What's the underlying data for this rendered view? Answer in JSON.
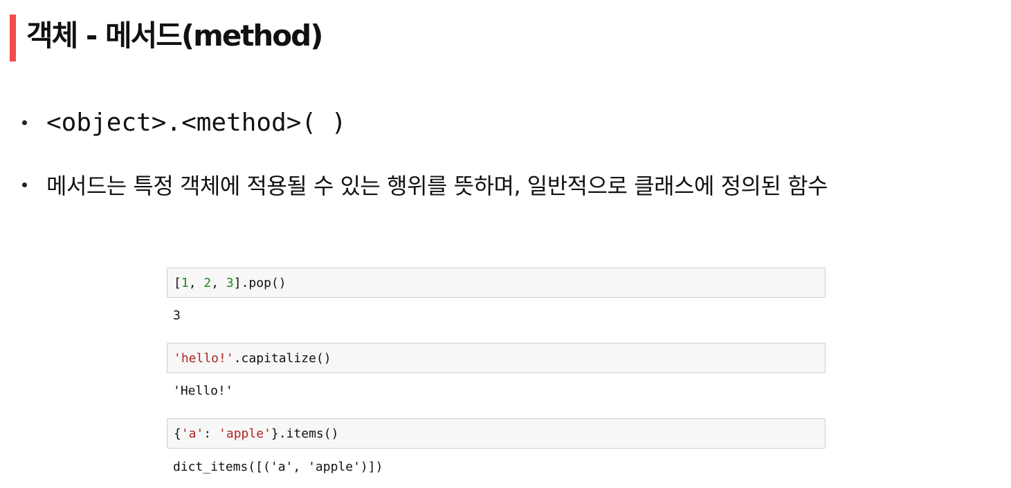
{
  "title": "객체 - 메서드(method)",
  "colors": {
    "accent_bar": "#f04e4e",
    "code_number": "#1b8a1b",
    "code_string": "#b22222",
    "cell_background": "#f7f7f7",
    "cell_border": "#cfcfcf"
  },
  "bullets": [
    {
      "text": "<object>.<method>( )"
    },
    {
      "text": "메서드는 특정 객체에 적용될 수 있는 행위를 뜻하며, 일반적으로 클래스에 정의된 함수"
    }
  ],
  "cells": [
    {
      "input": {
        "tokens": [
          {
            "text": "[",
            "kind": "plain"
          },
          {
            "text": "1",
            "kind": "num"
          },
          {
            "text": ", ",
            "kind": "plain"
          },
          {
            "text": "2",
            "kind": "num"
          },
          {
            "text": ", ",
            "kind": "plain"
          },
          {
            "text": "3",
            "kind": "num"
          },
          {
            "text": "].pop()",
            "kind": "plain"
          }
        ]
      },
      "output": "3"
    },
    {
      "input": {
        "tokens": [
          {
            "text": "'hello!'",
            "kind": "str"
          },
          {
            "text": ".capitalize()",
            "kind": "plain"
          }
        ]
      },
      "output": "'Hello!'"
    },
    {
      "input": {
        "tokens": [
          {
            "text": "{",
            "kind": "plain"
          },
          {
            "text": "'a'",
            "kind": "str"
          },
          {
            "text": ": ",
            "kind": "plain"
          },
          {
            "text": "'apple'",
            "kind": "str"
          },
          {
            "text": "}.items()",
            "kind": "plain"
          }
        ]
      },
      "output": "dict_items([('a', 'apple')])"
    }
  ]
}
